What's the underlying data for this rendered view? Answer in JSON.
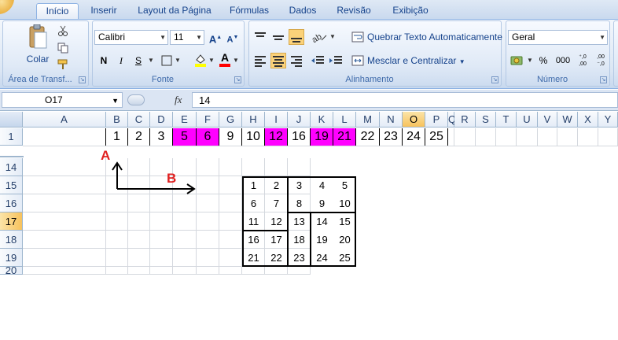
{
  "tabs": [
    "Início",
    "Inserir",
    "Layout da Página",
    "Fórmulas",
    "Dados",
    "Revisão",
    "Exibição"
  ],
  "clipboard": {
    "paste_label": "Colar",
    "group_label": "Área de Transf..."
  },
  "font": {
    "name": "Calibri",
    "size": "11",
    "bold": "N",
    "italic": "I",
    "underline": "S",
    "grow": "A",
    "shrink": "A",
    "color_letter": "A",
    "group_label": "Fonte"
  },
  "alignment": {
    "wrap_label": "Quebrar Texto Automaticamente",
    "merge_label": "Mesclar e Centralizar",
    "group_label": "Alinhamento"
  },
  "number": {
    "format": "Geral",
    "percent": "%",
    "thousands": "000",
    "inc_decimal": "⁺,0 ,00",
    "dec_decimal": ",00 ⁻,0",
    "group_label": "Número"
  },
  "formula_bar": {
    "name_box": "O17",
    "fx": "fx",
    "value": "14"
  },
  "columns": [
    "A",
    "B",
    "C",
    "D",
    "E",
    "F",
    "G",
    "H",
    "I",
    "J",
    "K",
    "L",
    "M",
    "N",
    "O",
    "P",
    "Q",
    "R",
    "S",
    "T",
    "U",
    "V",
    "W",
    "X",
    "Y"
  ],
  "selected_column": "O",
  "rows": [
    "1",
    "14",
    "15",
    "16",
    "17",
    "18",
    "19",
    "20"
  ],
  "selected_row": "17",
  "row1_values": [
    "1",
    "2",
    "3",
    "5",
    "6",
    "9",
    "10",
    "12",
    "16",
    "19",
    "21",
    "22",
    "23",
    "24",
    "25"
  ],
  "row1_highlight_color": "#ff00ff",
  "row1_highlighted": [
    "5",
    "6",
    "12",
    "19",
    "21"
  ],
  "block_values": [
    [
      "1",
      "2",
      "3",
      "4",
      "5"
    ],
    [
      "6",
      "7",
      "8",
      "9",
      "10"
    ],
    [
      "11",
      "12",
      "13",
      "14",
      "15"
    ],
    [
      "16",
      "17",
      "18",
      "19",
      "20"
    ],
    [
      "21",
      "22",
      "23",
      "24",
      "25"
    ]
  ],
  "annotations": {
    "a_label": "A",
    "b_label": "B",
    "label_color": "#e02020"
  }
}
